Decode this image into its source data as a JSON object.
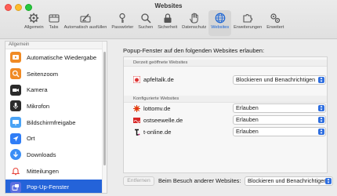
{
  "window": {
    "title": "Websites"
  },
  "toolbar": {
    "items": [
      {
        "label": "Allgemein",
        "icon": "gear-icon"
      },
      {
        "label": "Tabs",
        "icon": "tabs-icon"
      },
      {
        "label": "Automatisch ausfüllen",
        "icon": "autofill-pencil-icon"
      },
      {
        "label": "Passwörter",
        "icon": "key-icon"
      },
      {
        "label": "Suchen",
        "icon": "magnifier-icon"
      },
      {
        "label": "Sicherheit",
        "icon": "lock-icon"
      },
      {
        "label": "Datenschutz",
        "icon": "hand-icon"
      },
      {
        "label": "Websites",
        "icon": "globe-icon",
        "active": true
      },
      {
        "label": "Erweiterungen",
        "icon": "puzzle-icon"
      },
      {
        "label": "Erweitert",
        "icon": "gears-icon"
      }
    ],
    "accent": "#1a64d4"
  },
  "sidebar": {
    "header": "Allgemein",
    "items": [
      {
        "label": "Automatische Wiedergabe",
        "icon": "play-icon",
        "color": "#f08a24"
      },
      {
        "label": "Seitenzoom",
        "icon": "zoom-icon",
        "color": "#f08a24"
      },
      {
        "label": "Kamera",
        "icon": "camera-icon",
        "color": "#2b2b2b"
      },
      {
        "label": "Mikrofon",
        "icon": "microphone-icon",
        "color": "#2b2b2b"
      },
      {
        "label": "Bildschirmfreigabe",
        "icon": "screen-share-icon",
        "color": "#4aa3f5"
      },
      {
        "label": "Ort",
        "icon": "location-icon",
        "color": "#2f7df6"
      },
      {
        "label": "Downloads",
        "icon": "download-icon",
        "color": "#3b8ef5"
      },
      {
        "label": "Mitteilungen",
        "icon": "bell-icon",
        "color": "#e8453c"
      },
      {
        "label": "Pop-Up-Fenster",
        "icon": "popup-window-icon",
        "color": "#5b6ee0",
        "selected": true
      }
    ],
    "selected_color": "#2463d9"
  },
  "main": {
    "title": "Popup-Fenster auf den folgenden Websites erlauben:",
    "current_section": "Derzeit geöffnete Websites",
    "current_sites": [
      {
        "name": "apfeltalk.de",
        "value": "Blockieren und Benachrichtigen",
        "favicon": "apfeltalk-favicon"
      }
    ],
    "configured_section": "Konfigurierte Websites",
    "configured_sites": [
      {
        "name": "lottomv.de",
        "value": "Erlauben",
        "favicon": "lottomv-favicon"
      },
      {
        "name": "ostseewelle.de",
        "value": "Erlauben",
        "favicon": "ostseewelle-favicon"
      },
      {
        "name": "t-online.de",
        "value": "Erlauben",
        "favicon": "t-online-favicon"
      }
    ],
    "remove_button": "Entfernen",
    "other_sites_label": "Beim Besuch anderer Websites:",
    "other_sites_value": "Blockieren und Benachrichtigen"
  }
}
